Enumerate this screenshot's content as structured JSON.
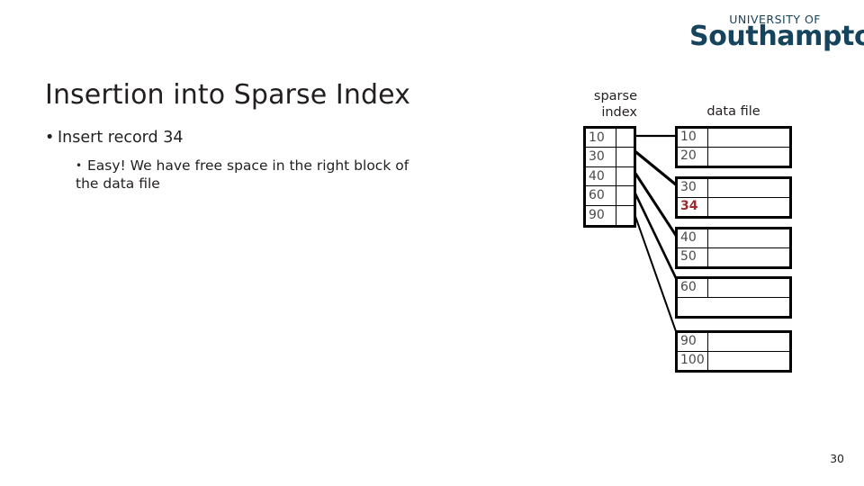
{
  "logo": {
    "line1": "UNIVERSITY OF",
    "line2": "Southampton",
    "color": "#16445C"
  },
  "title": "Insertion into Sparse Index",
  "bullets": {
    "level1": "Insert record 34",
    "level1_marker": "•",
    "level2": "Easy! We have free space in the right block of the data file",
    "level2_marker": "•"
  },
  "diagram": {
    "index_label": "sparse\nindex",
    "index_label_line1": "sparse",
    "index_label_line2": "index",
    "data_label": "data file",
    "sparse_index": {
      "keys": [
        "10",
        "30",
        "40",
        "60",
        "90"
      ]
    },
    "data_file": {
      "blocks": [
        {
          "records": [
            {
              "key": "10",
              "highlight": false
            },
            {
              "key": "20",
              "highlight": false
            }
          ]
        },
        {
          "records": [
            {
              "key": "30",
              "highlight": false
            },
            {
              "key": "34",
              "highlight": true
            }
          ]
        },
        {
          "records": [
            {
              "key": "40",
              "highlight": false
            },
            {
              "key": "50",
              "highlight": false
            }
          ]
        },
        {
          "records": [
            {
              "key": "60",
              "highlight": false
            },
            {
              "key": "",
              "highlight": false
            }
          ]
        },
        {
          "records": [
            {
              "key": "90",
              "highlight": false
            },
            {
              "key": "100",
              "highlight": false
            }
          ]
        }
      ]
    },
    "highlight_color": "#9E2A2B",
    "line_color": "#000000"
  },
  "page_number": "30"
}
